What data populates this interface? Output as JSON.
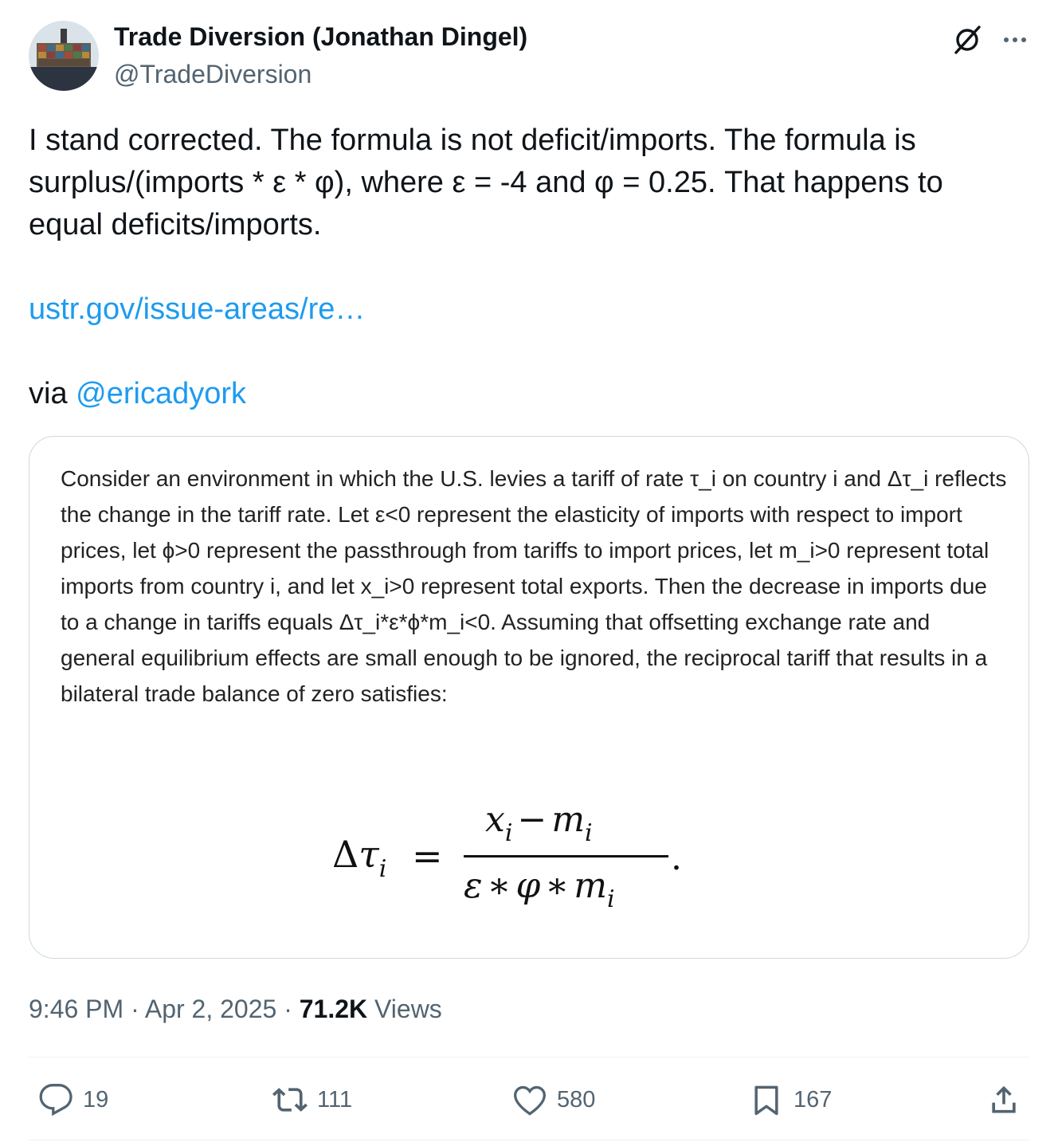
{
  "author": {
    "name": "Trade Diversion (Jonathan Dingel)",
    "handle": "@TradeDiversion",
    "avatar_icon": "container-ship-avatar"
  },
  "tweet": {
    "line1": "I stand corrected. The formula is not deficit/imports. The formula is surplus/(imports * ε * φ), where ε = -4 and φ = 0.25. That happens to equal deficits/imports.",
    "link": "ustr.gov/issue-areas/re…",
    "via_prefix": "via ",
    "mention": "@ericadyork"
  },
  "image": {
    "paragraph": "Consider an environment in which the U.S. levies a tariff of rate τ_i on country i and Δτ_i reflects the change in the tariff rate. Let ε<0 represent the elasticity of imports with respect to import prices, let ϕ>0 represent the passthrough from tariffs to import prices, let m_i>0 represent total imports from country i, and let x_i>0 represent total exports. Then the decrease in imports due to a change in tariffs equals Δτ_i*ε*ϕ*m_i<0. Assuming that offsetting exchange rate and general equilibrium effects are small enough to be ignored, the reciprocal tariff that results in a bilateral trade balance of zero satisfies:",
    "formula": {
      "lhs_delta": "Δ",
      "lhs_var": "τ",
      "sub_i": "i",
      "equals": "=",
      "num_x": "x",
      "minus": "−",
      "num_m": "m",
      "den_eps": "ε",
      "star": "∗",
      "den_phi": "φ",
      "den_m": "m",
      "period": "."
    }
  },
  "meta": {
    "time": "9:46 PM",
    "sep": " · ",
    "date": "Apr 2, 2025",
    "views_count": "71.2K",
    "views_label": " Views"
  },
  "actions": {
    "replies": "19",
    "reposts": "111",
    "likes": "580",
    "bookmarks": "167"
  },
  "colors": {
    "link": "#1d9bf0",
    "secondary_text": "#536471",
    "border": "#cfd9de"
  }
}
